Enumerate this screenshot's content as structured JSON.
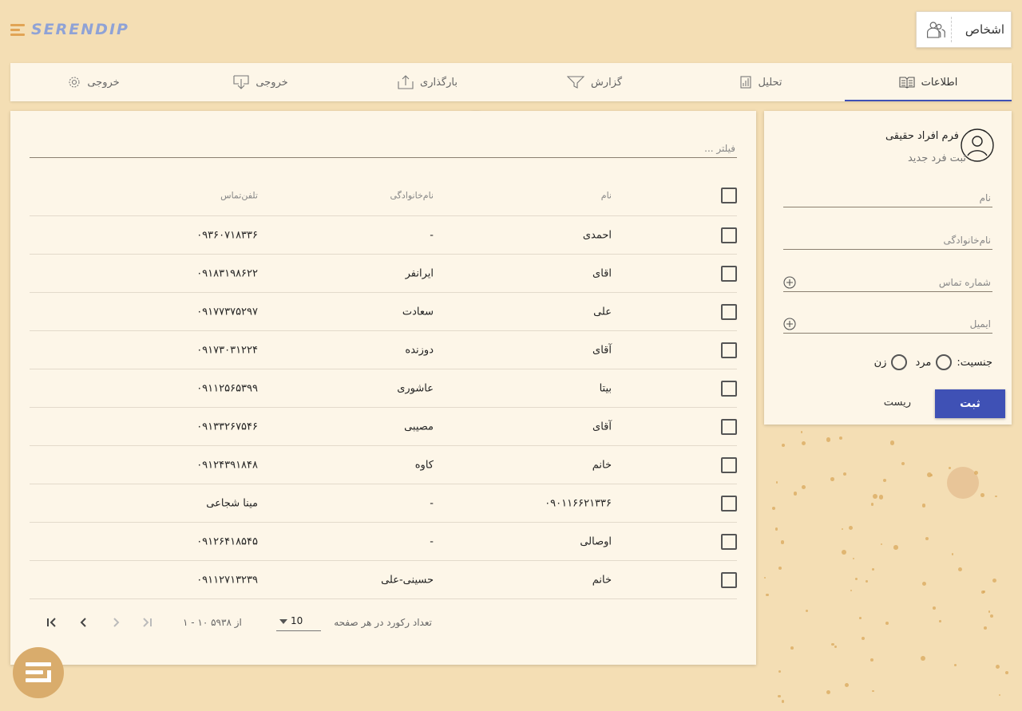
{
  "brand": {
    "logo_text": "SERENDIP",
    "accent": "#e1a455"
  },
  "module": {
    "label": "اشخاص",
    "icon": "people-icon"
  },
  "tabs": [
    {
      "label": "اطلاعات",
      "icon": "book-icon",
      "active": true
    },
    {
      "label": "تحلیل",
      "icon": "bar-chart-icon",
      "active": false
    },
    {
      "label": "گزارش",
      "icon": "filter-icon",
      "active": false
    },
    {
      "label": "بارگذاری",
      "icon": "upload-icon",
      "active": false
    },
    {
      "label": "خروجی",
      "icon": "download-icon",
      "active": false
    },
    {
      "label": "خروجی",
      "icon": "gear-icon",
      "active": false
    }
  ],
  "table": {
    "filter_placeholder": "فیلتر ...",
    "columns": {
      "name": "نام",
      "family": "نام‌خانوادگی",
      "phone": "تلفن‌تماس"
    },
    "rows": [
      {
        "name": "احمدی",
        "family": "-",
        "phone": "۰۹۳۶۰۷۱۸۳۳۶"
      },
      {
        "name": "اقای",
        "family": "ایرانفر",
        "phone": "۰۹۱۸۳۱۹۸۶۲۲"
      },
      {
        "name": "علی",
        "family": "سعادت",
        "phone": "۰۹۱۷۷۳۷۵۲۹۷"
      },
      {
        "name": "آقای",
        "family": "دوزنده",
        "phone": "۰۹۱۷۳۰۳۱۲۲۴"
      },
      {
        "name": "بیتا",
        "family": "عاشوری",
        "phone": "۰۹۱۱۲۵۶۵۳۹۹"
      },
      {
        "name": "آقای",
        "family": "مصیبی",
        "phone": "۰۹۱۳۳۲۶۷۵۴۶"
      },
      {
        "name": "خانم",
        "family": "کاوه",
        "phone": "۰۹۱۲۴۳۹۱۸۴۸"
      },
      {
        "name": "۰۹۰۱۱۶۶۲۱۳۳۶",
        "family": "-",
        "phone": "مینا شجاعی"
      },
      {
        "name": "اوصالی",
        "family": "-",
        "phone": "۰۹۱۲۶۴۱۸۵۴۵"
      },
      {
        "name": "خانم",
        "family": "حسینی-علی",
        "phone": "۰۹۱۱۲۷۱۳۲۳۹"
      }
    ]
  },
  "pager": {
    "rows_per_page_label": "تعداد رکورد در هر صفحه",
    "rows_per_page_value": "10",
    "range_text": "۱ - ۱۰ از ۵۹۳۸"
  },
  "form": {
    "title": "فرم افراد حقیقی",
    "subtitle": "ثبت فرد جدید",
    "name_placeholder": "نام",
    "family_placeholder": "نام‌خانوادگی",
    "phone_placeholder": "شماره تماس",
    "email_placeholder": "ایمیل",
    "gender_label": "جنسیت:",
    "gender_male": "مرد",
    "gender_female": "زن",
    "submit_label": "ثبت",
    "reset_label": "ریست",
    "submit_color": "#3f51b5"
  }
}
